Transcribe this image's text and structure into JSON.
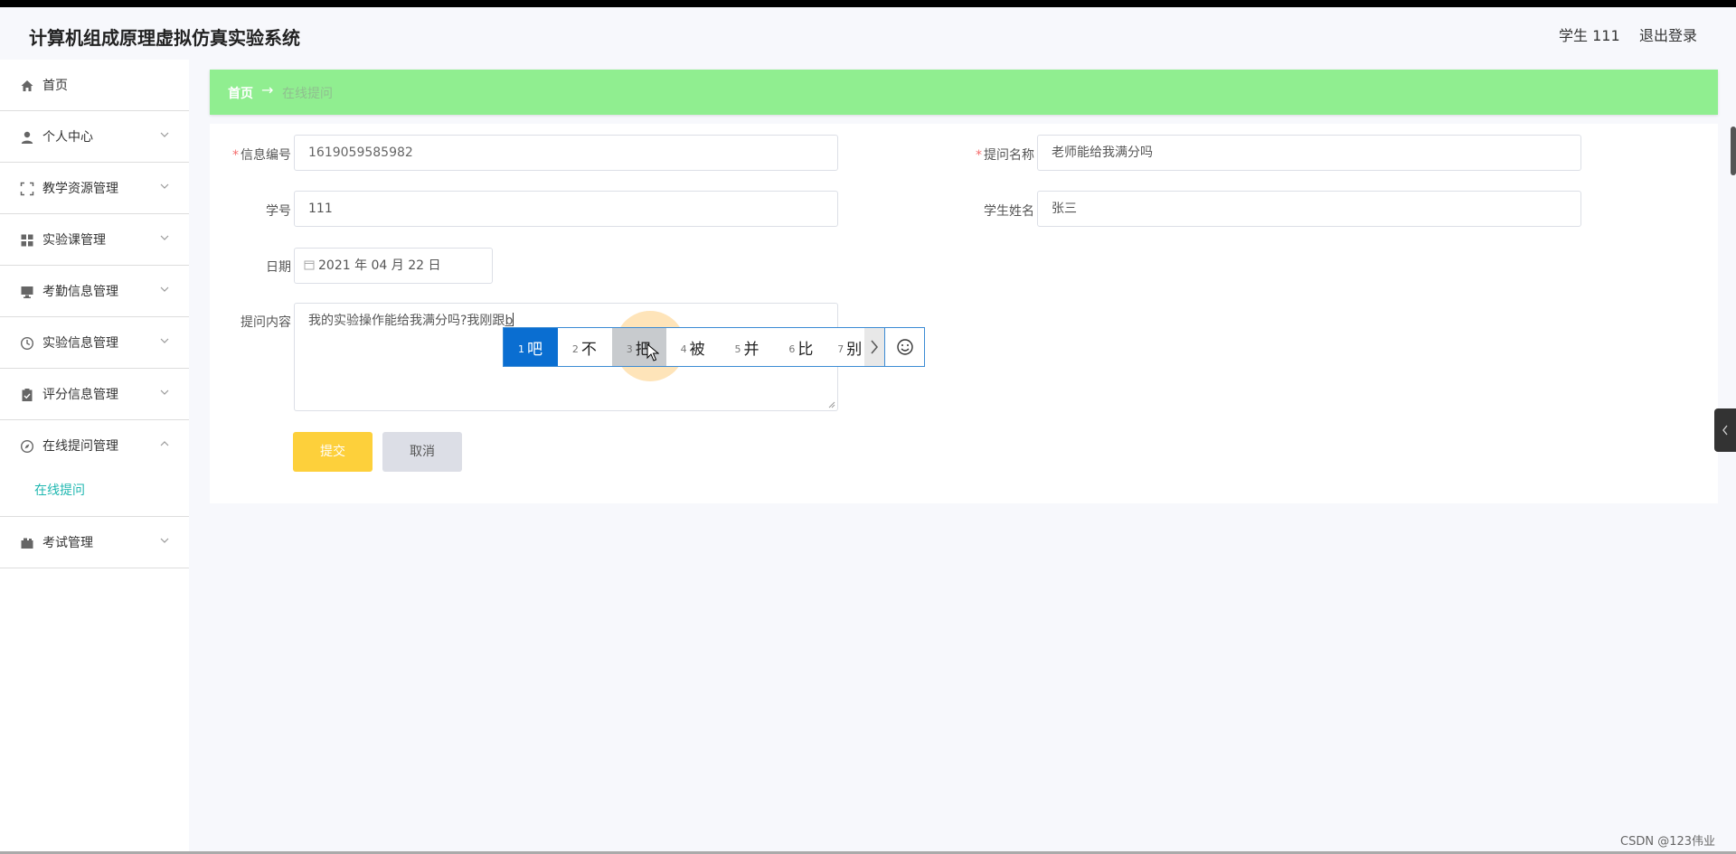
{
  "app": {
    "title": "计算机组成原理虚拟仿真实验系统"
  },
  "header": {
    "user": "学生 111",
    "logout": "退出登录"
  },
  "sidebar": {
    "items": [
      {
        "label": "首页",
        "icon": "home-icon",
        "expandable": false
      },
      {
        "label": "个人中心",
        "icon": "user-icon",
        "expandable": true
      },
      {
        "label": "教学资源管理",
        "icon": "fullscreen-icon",
        "expandable": true
      },
      {
        "label": "实验课管理",
        "icon": "grid-icon",
        "expandable": true
      },
      {
        "label": "考勤信息管理",
        "icon": "monitor-icon",
        "expandable": true
      },
      {
        "label": "实验信息管理",
        "icon": "clock-icon",
        "expandable": true
      },
      {
        "label": "评分信息管理",
        "icon": "clipboard-icon",
        "expandable": true
      },
      {
        "label": "在线提问管理",
        "icon": "compass-icon",
        "expandable": true,
        "open": true
      },
      {
        "label": "考试管理",
        "icon": "camera-icon",
        "expandable": true
      }
    ],
    "submenu": {
      "label": "在线提问"
    }
  },
  "breadcrumb": {
    "home": "首页",
    "separator": "→",
    "current": "在线提问"
  },
  "form": {
    "info_no": {
      "label": "信息编号",
      "value": "1619059585982",
      "required": true
    },
    "question_name": {
      "label": "提问名称",
      "value": "老师能给我满分吗",
      "required": true
    },
    "student_no": {
      "label": "学号",
      "value": "111"
    },
    "student_name": {
      "label": "学生姓名",
      "value": "张三"
    },
    "date": {
      "label": "日期",
      "value": "2021 年 04 月 22 日"
    },
    "content": {
      "label": "提问内容",
      "value": "我的实验操作能给我满分吗?我刚跟",
      "composing": "b"
    },
    "submit_label": "提交",
    "cancel_label": "取消"
  },
  "ime": {
    "candidates": [
      {
        "num": "1",
        "char": "吧"
      },
      {
        "num": "2",
        "char": "不"
      },
      {
        "num": "3",
        "char": "把"
      },
      {
        "num": "4",
        "char": "被"
      },
      {
        "num": "5",
        "char": "并"
      },
      {
        "num": "6",
        "char": "比"
      },
      {
        "num": "7",
        "char": "别"
      }
    ],
    "selected_index": 0,
    "hover_index": 2
  },
  "watermark": "CSDN @123伟业",
  "colors": {
    "accent": "#1fb7b0",
    "breadcrumb_bg": "#90ee90",
    "submit": "#fdd03b",
    "ime_selected": "#0a6ed1",
    "required": "#f56c6c"
  }
}
